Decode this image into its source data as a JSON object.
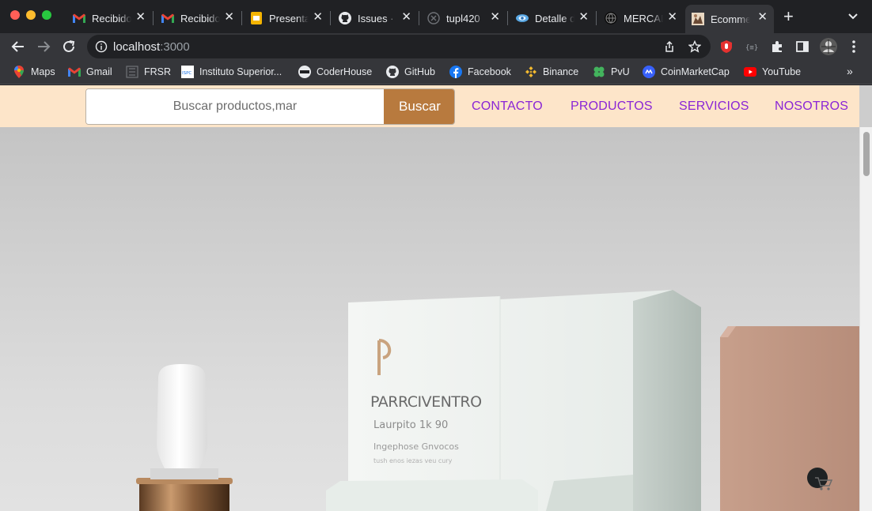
{
  "browser": {
    "tabs": [
      {
        "title": "Recibido",
        "icon": "gmail-icon",
        "active": false
      },
      {
        "title": "Recibido",
        "icon": "gmail-icon",
        "active": false
      },
      {
        "title": "Presenta",
        "icon": "slides-icon",
        "active": false
      },
      {
        "title": "Issues · ",
        "icon": "github-icon",
        "active": false
      },
      {
        "title": "tupl420",
        "icon": "repo-icon",
        "active": false
      },
      {
        "title": "Detalle d",
        "icon": "eye-icon",
        "active": false
      },
      {
        "title": "MERCAD",
        "icon": "globe-icon",
        "active": false
      },
      {
        "title": "Ecomme",
        "icon": "ecommerce-icon",
        "active": true
      }
    ],
    "address": {
      "host": "localhost",
      "port": ":3000"
    },
    "bookmarks": [
      {
        "label": "Maps",
        "icon": "maps-icon"
      },
      {
        "label": "Gmail",
        "icon": "gmail-icon"
      },
      {
        "label": "FRSR",
        "icon": "frsr-icon"
      },
      {
        "label": "Instituto Superior...",
        "icon": "ispc-icon"
      },
      {
        "label": "CoderHouse",
        "icon": "coderhouse-icon"
      },
      {
        "label": "GitHub",
        "icon": "github-icon"
      },
      {
        "label": "Facebook",
        "icon": "facebook-icon"
      },
      {
        "label": "Binance",
        "icon": "binance-icon"
      },
      {
        "label": "PvU",
        "icon": "clover-icon"
      },
      {
        "label": "CoinMarketCap",
        "icon": "coinmarketcap-icon"
      },
      {
        "label": "YouTube",
        "icon": "youtube-icon"
      }
    ]
  },
  "site": {
    "search": {
      "placeholder": "Buscar productos,mar",
      "button_label": "Buscar"
    },
    "nav": [
      "CONTACTO",
      "PRODUCTOS",
      "SERVICIOS",
      "NOSOTROS"
    ],
    "hero_packaging": {
      "brand": "PARRCIVENTRO",
      "line2": "Laurpito 1k 90",
      "line3": "Ingephose Gnvocos",
      "line4": "tush enos iezas veu cury"
    }
  },
  "colors": {
    "nav_bg": "#fde5c9",
    "search_button": "#b87a3e",
    "nav_link": "#8a25d6"
  }
}
